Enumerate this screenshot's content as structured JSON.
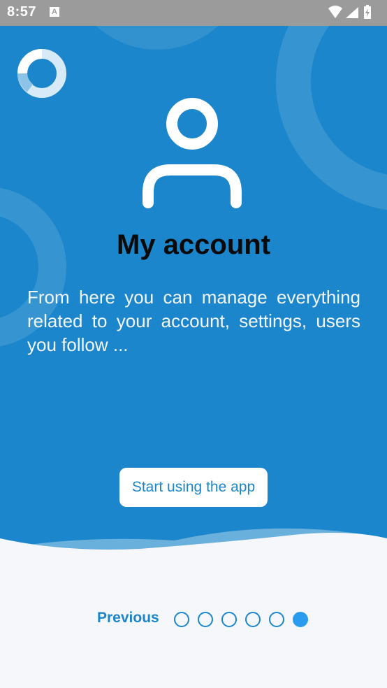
{
  "status_bar": {
    "time": "8:57",
    "icons": [
      "a-notification-icon",
      "wifi-icon",
      "signal-icon",
      "battery-charging-icon"
    ]
  },
  "onboarding": {
    "title": "My account",
    "description": "From here you can manage everything related to your account, settings, users you follow ...",
    "start_button_label": "Start using the app"
  },
  "navigation": {
    "previous_label": "Previous",
    "total_pages": 6,
    "current_page": 6
  },
  "colors": {
    "primary": "#1b86cb",
    "active_dot": "#2a9cf0",
    "background": "#f6f7fb"
  }
}
